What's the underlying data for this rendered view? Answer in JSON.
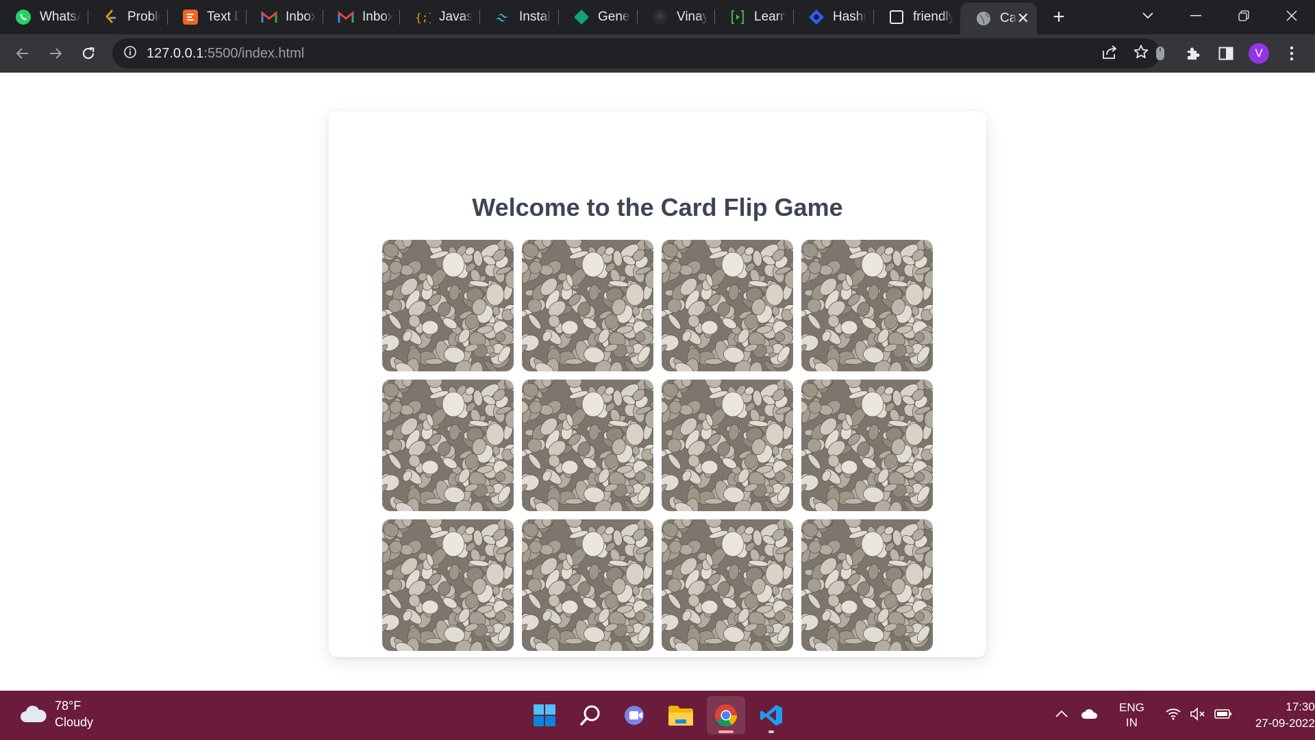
{
  "browser": {
    "tabs": [
      {
        "title": "WhatsA",
        "icon": "whatsapp-icon"
      },
      {
        "title": "Problem",
        "icon": "leetcode-icon"
      },
      {
        "title": "Text Di",
        "icon": "text-diff-icon"
      },
      {
        "title": "Inbox -",
        "icon": "gmail-icon"
      },
      {
        "title": "Inbox (",
        "icon": "gmail-icon"
      },
      {
        "title": "Javascr",
        "icon": "code-braces-icon"
      },
      {
        "title": "Installa",
        "icon": "tailwind-icon"
      },
      {
        "title": "Genera",
        "icon": "diamond-icon"
      },
      {
        "title": "Vinay-I",
        "icon": "github-icon"
      },
      {
        "title": "Learn c",
        "icon": "code-play-icon"
      },
      {
        "title": "Hashnc",
        "icon": "hashnode-icon"
      },
      {
        "title": "friendly",
        "icon": "blank-page-icon"
      },
      {
        "title": "Car",
        "icon": "globe-icon",
        "active": true
      }
    ],
    "url_host": "127.0.0.1",
    "url_rest": ":5500/index.html",
    "profile_initial": "V"
  },
  "page": {
    "title": "Welcome to the Card Flip Game",
    "card_back": "pebbles",
    "cards": [
      {
        "state": "face-down"
      },
      {
        "state": "face-down"
      },
      {
        "state": "face-down"
      },
      {
        "state": "face-down"
      },
      {
        "state": "face-down"
      },
      {
        "state": "face-down"
      },
      {
        "state": "face-down"
      },
      {
        "state": "face-down"
      },
      {
        "state": "face-down"
      },
      {
        "state": "face-down"
      },
      {
        "state": "face-down"
      },
      {
        "state": "face-down"
      }
    ]
  },
  "taskbar": {
    "weather_temp": "78°F",
    "weather_desc": "Cloudy",
    "lang_line1": "ENG",
    "lang_line2": "IN",
    "time": "17:30",
    "date": "27-09-2022",
    "apps": [
      "start-icon",
      "search-icon",
      "teams-icon",
      "file-explorer-icon",
      "chrome-icon",
      "vscode-icon"
    ]
  }
}
